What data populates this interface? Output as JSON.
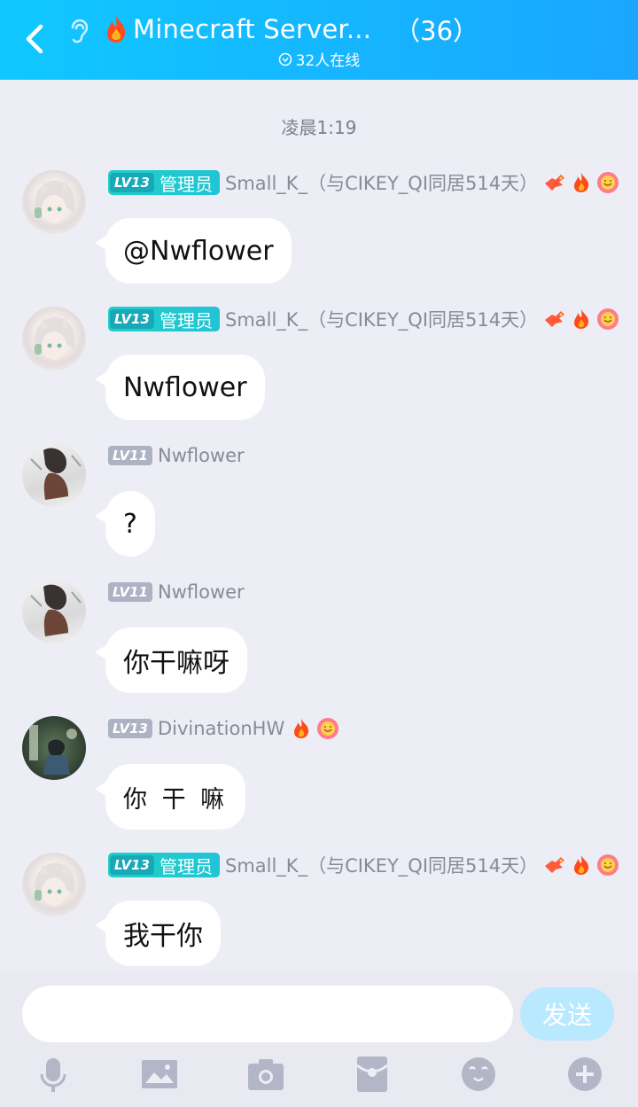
{
  "header": {
    "title": "Minecraft Server...",
    "member_count": "（36）",
    "online": "32人在线"
  },
  "timestamp": "凌晨1:19",
  "messages": [
    {
      "level": "LV13",
      "role": "管理员",
      "name": "Small_K_（与CIKEY_QI同居514天）",
      "text": "@Nwflower"
    },
    {
      "level": "LV13",
      "role": "管理员",
      "name": "Small_K_（与CIKEY_QI同居514天）",
      "text": "Nwflower"
    },
    {
      "level": "LV11",
      "role": "",
      "name": "Nwflower",
      "text": "?"
    },
    {
      "level": "LV11",
      "role": "",
      "name": "Nwflower",
      "text": "你干嘛呀"
    },
    {
      "level": "LV13",
      "role": "",
      "name": "DivinationHW",
      "text": "你 干 嘛"
    },
    {
      "level": "LV13",
      "role": "管理员",
      "name": "Small_K_（与CIKEY_QI同居514天）",
      "text": "我干你"
    }
  ],
  "input": {
    "value": "",
    "placeholder": "",
    "send_label": "发送"
  },
  "toolbar": [
    "mic-icon",
    "image-icon",
    "camera-icon",
    "red-packet-icon",
    "emoji-icon",
    "plus-icon"
  ],
  "colors": {
    "header_start": "#10c8ff",
    "header_end": "#1aa6ff",
    "background": "#ededf5",
    "admin_badge": "#1fd0c6",
    "send_disabled": "#b9e9ff"
  }
}
